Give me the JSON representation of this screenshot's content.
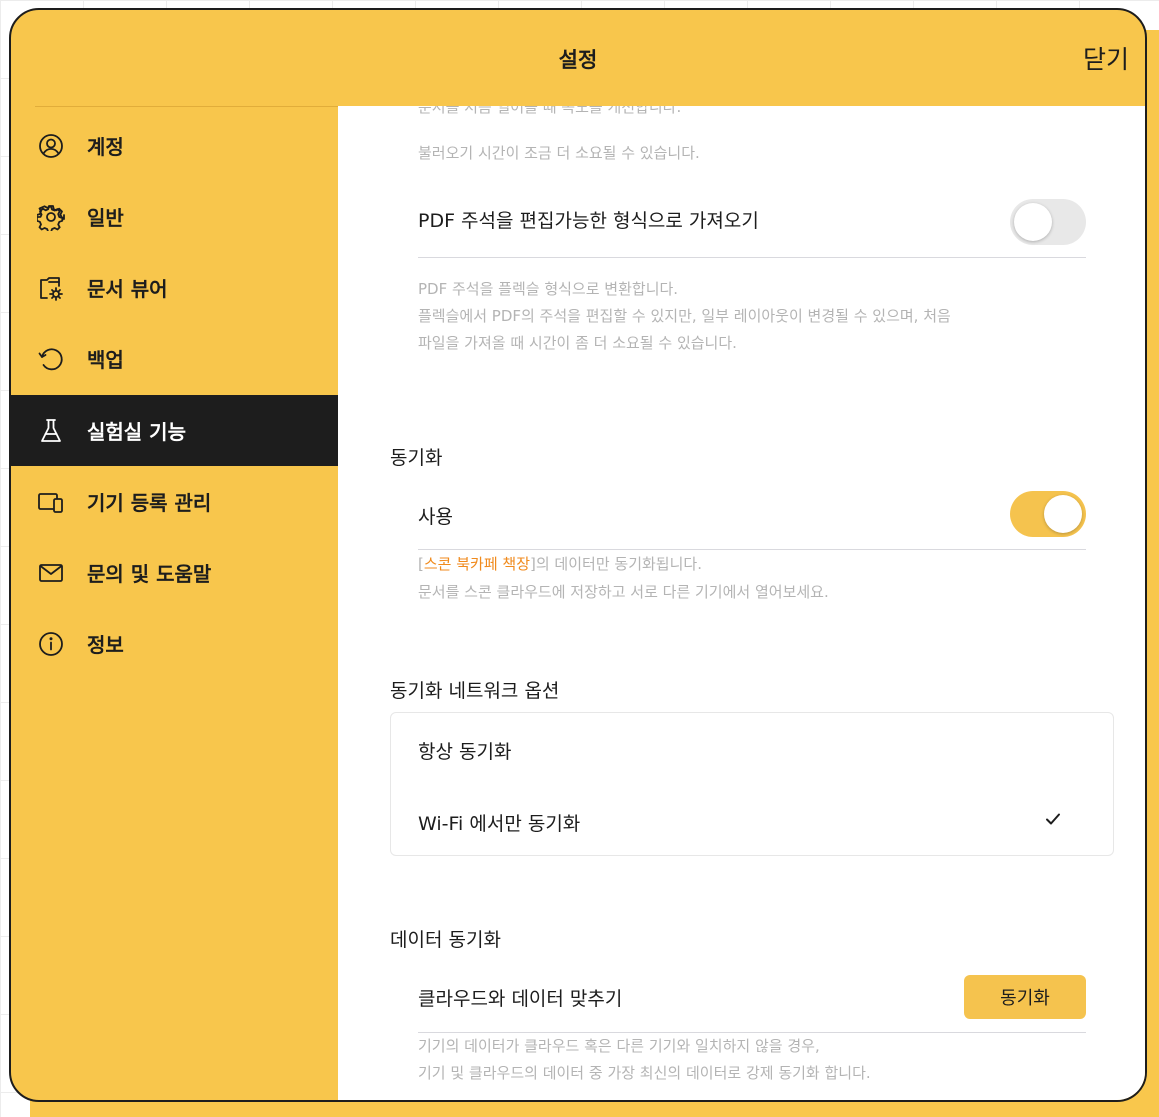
{
  "header": {
    "title": "설정",
    "close_label": "닫기"
  },
  "sidebar": {
    "items": [
      {
        "label": "계정",
        "icon": "account-icon"
      },
      {
        "label": "일반",
        "icon": "gear-icon"
      },
      {
        "label": "문서 뷰어",
        "icon": "document-viewer-icon"
      },
      {
        "label": "백업",
        "icon": "backup-icon"
      },
      {
        "label": "실험실 기능",
        "icon": "flask-icon",
        "active": true
      },
      {
        "label": "기기 등록 관리",
        "icon": "devices-icon"
      },
      {
        "label": "문의 및 도움말",
        "icon": "mail-icon"
      },
      {
        "label": "정보",
        "icon": "info-icon"
      }
    ]
  },
  "main": {
    "top_desc_cut": "문서를 처음 열어볼 때 속도를 개선합니다.",
    "top_desc": "불러오기 시간이 조금 더 소요될 수 있습니다.",
    "pdf_annotation": {
      "label": "PDF 주석을 편집가능한 형식으로 가져오기",
      "toggle_on": false,
      "desc_1": "PDF 주석을 플렉슬 형식으로 변환합니다.",
      "desc_2": "플렉슬에서 PDF의 주석을 편집할 수 있지만, 일부 레이아웃이 변경될 수 있으며, 처음",
      "desc_3": "파일을 가져올 때 시간이 좀 더 소요될 수 있습니다."
    },
    "sync": {
      "section_title": "동기화",
      "enable_label": "사용",
      "toggle_on": true,
      "desc_open": "[",
      "desc_highlight": "스콘 북카페 책장",
      "desc_rest": "]의 데이터만 동기화됩니다.",
      "desc_2": "문서를 스콘 클라우드에 저장하고 서로 다른 기기에서 열어보세요."
    },
    "network": {
      "section_title": "동기화 네트워크 옵션",
      "options": [
        {
          "label": "항상 동기화",
          "checked": false
        },
        {
          "label": "Wi-Fi 에서만 동기화",
          "checked": true
        }
      ]
    },
    "data_sync": {
      "section_title": "데이터 동기화",
      "row_label": "클라우드와 데이터 맞추기",
      "button_label": "동기화",
      "desc_1": "기기의 데이터가 클라우드 혹은 다른 기기와 일치하지 않을 경우,",
      "desc_2": "기기 및 클라우드의 데이터 중 가장 최신의 데이터로 강제 동기화 합니다."
    }
  },
  "colors": {
    "accent": "#f8c64c",
    "toggle_on": "#f5c34e",
    "highlight": "#f08a1c",
    "active_bg": "#1d1d1d"
  }
}
